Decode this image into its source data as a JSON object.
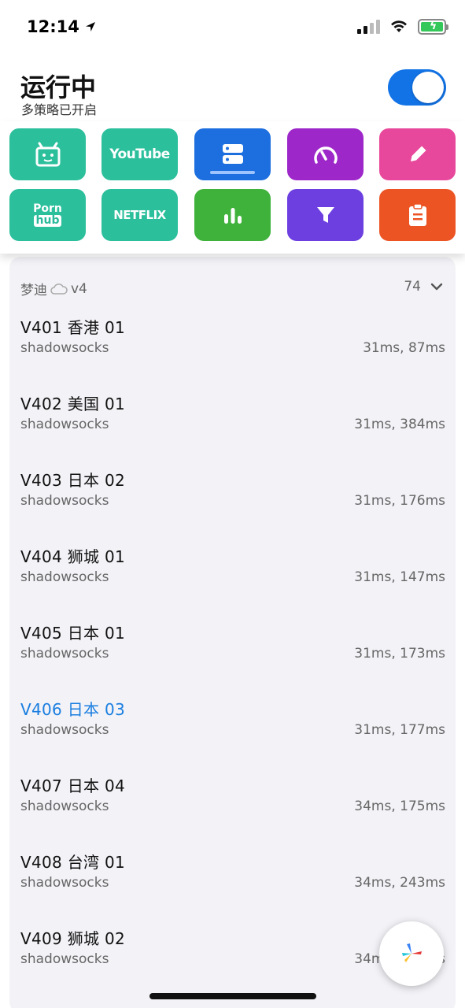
{
  "status": {
    "time": "12:14"
  },
  "header": {
    "title": "运行中",
    "subtitle": "多策略已开启",
    "toggle_on": true
  },
  "tiles": [
    {
      "name": "bilibili",
      "icon": "tv-face-icon",
      "color": "#2bbf9c"
    },
    {
      "name": "youtube",
      "label": "YouTube",
      "color": "#2bbf9c"
    },
    {
      "name": "server",
      "icon": "server-icon",
      "color": "#1d6fe0",
      "selected": true
    },
    {
      "name": "speed",
      "icon": "speedometer-icon",
      "color": "#9d27c9"
    },
    {
      "name": "edit",
      "icon": "pencil-icon",
      "color": "#e8489b"
    },
    {
      "name": "pornhub",
      "label_top": "Porn",
      "label_bottom": "hub",
      "color": "#2bbf9c"
    },
    {
      "name": "netflix",
      "label": "NETFLIX",
      "color": "#2bbf9c"
    },
    {
      "name": "stats",
      "icon": "bar-chart-icon",
      "color": "#3fb23c"
    },
    {
      "name": "filter",
      "icon": "filter-icon",
      "color": "#6d3fe0"
    },
    {
      "name": "clipboard",
      "icon": "clipboard-icon",
      "color": "#ec5424"
    }
  ],
  "group": {
    "name": "梦迪",
    "version": "v4",
    "count": "74"
  },
  "servers": [
    {
      "name": "V401 香港 01",
      "protocol": "shadowsocks",
      "latency": "31ms, 87ms"
    },
    {
      "name": "V402 美国 01",
      "protocol": "shadowsocks",
      "latency": "31ms, 384ms"
    },
    {
      "name": "V403 日本 02",
      "protocol": "shadowsocks",
      "latency": "31ms, 176ms"
    },
    {
      "name": "V404 狮城 01",
      "protocol": "shadowsocks",
      "latency": "31ms, 147ms"
    },
    {
      "name": "V405 日本 01",
      "protocol": "shadowsocks",
      "latency": "31ms, 173ms"
    },
    {
      "name": "V406 日本 03",
      "protocol": "shadowsocks",
      "latency": "31ms, 177ms",
      "active": true
    },
    {
      "name": "V407 日本 04",
      "protocol": "shadowsocks",
      "latency": "34ms, 175ms"
    },
    {
      "name": "V408 台湾 01",
      "protocol": "shadowsocks",
      "latency": "34ms, 243ms"
    },
    {
      "name": "V409 狮城 02",
      "protocol": "shadowsocks",
      "latency": "34ms, 195ms"
    }
  ],
  "colors": {
    "accent": "#1273e6",
    "active_text": "#1a7ee0"
  }
}
